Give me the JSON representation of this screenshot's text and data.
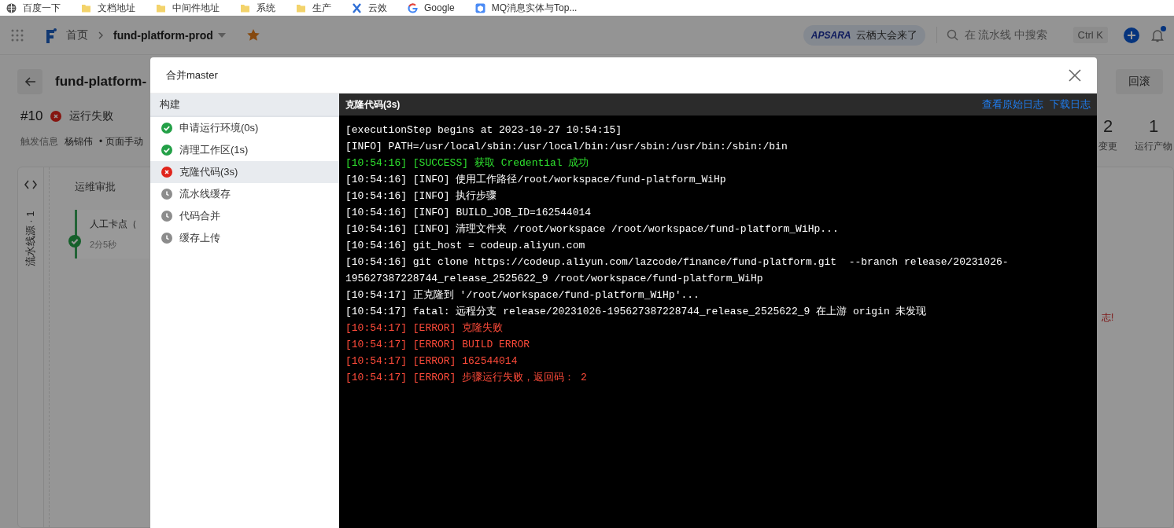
{
  "bookmarks": [
    {
      "label": "百度一下",
      "kind": "globe"
    },
    {
      "label": "文档地址",
      "kind": "folder"
    },
    {
      "label": "中间件地址",
      "kind": "folder"
    },
    {
      "label": "系统",
      "kind": "folder"
    },
    {
      "label": "生产",
      "kind": "folder"
    },
    {
      "label": "云效",
      "kind": "cross"
    },
    {
      "label": "Google",
      "kind": "google"
    },
    {
      "label": "MQ消息实体与Top...",
      "kind": "cube"
    }
  ],
  "header": {
    "breadcrumb": [
      "首页",
      "fund-platform-prod"
    ],
    "starred": true,
    "promo": {
      "logo": "APSARA",
      "text": "云栖大会来了"
    },
    "search": {
      "placeholder": "在 流水线 中搜索",
      "shortcut": "Ctrl K"
    },
    "notification_dot": true
  },
  "page": {
    "title": "fund-platform-",
    "buttons": [
      "回滚"
    ],
    "run": {
      "number": "#10",
      "status": "运行失败",
      "kind": "failed"
    },
    "trigger": {
      "label": "触发信息",
      "user": "杨锦伟",
      "detail": "• 页面手动"
    },
    "stats": [
      {
        "value": "2",
        "label": "变更"
      },
      {
        "value": "1",
        "label": "运行产物"
      }
    ],
    "source": "流水线源 · 1",
    "stage": {
      "title": "运维审批",
      "job": {
        "name": "人工卡点（",
        "duration": "2分5秒",
        "kind": "success"
      }
    },
    "error_note": "志!"
  },
  "modal": {
    "title": "合并master",
    "steps_header": "构建",
    "steps": [
      {
        "name": "申请运行环境(0s)",
        "kind": "success",
        "selected": false
      },
      {
        "name": "清理工作区(1s)",
        "kind": "success",
        "selected": false
      },
      {
        "name": "克隆代码(3s)",
        "kind": "failed",
        "selected": true
      },
      {
        "name": "流水线缓存",
        "kind": "pending",
        "selected": false
      },
      {
        "name": "代码合并",
        "kind": "pending",
        "selected": false
      },
      {
        "name": "缓存上传",
        "kind": "pending",
        "selected": false
      }
    ],
    "log": {
      "title": "克隆代码(3s)",
      "links": [
        "查看原始日志",
        "下载日志"
      ],
      "lines": [
        {
          "text": "[executionStep begins at 2023-10-27 10:54:15]",
          "kind": "plain"
        },
        {
          "text": "[INFO] PATH=/usr/local/sbin:/usr/local/bin:/usr/sbin:/usr/bin:/sbin:/bin",
          "kind": "plain"
        },
        {
          "text": "[10:54:16] [SUCCESS] 获取 Credential 成功",
          "kind": "success"
        },
        {
          "text": "[10:54:16] [INFO] 使用工作路径/root/workspace/fund-platform_WiHp",
          "kind": "plain"
        },
        {
          "text": "[10:54:16] [INFO] 执行步骤",
          "kind": "plain"
        },
        {
          "text": "[10:54:16] [INFO] BUILD_JOB_ID=162544014",
          "kind": "plain"
        },
        {
          "text": "[10:54:16] [INFO] 清理文件夹 /root/workspace /root/workspace/fund-platform_WiHp...",
          "kind": "plain"
        },
        {
          "text": "[10:54:16] git_host = codeup.aliyun.com",
          "kind": "plain"
        },
        {
          "text": "[10:54:16] git clone https://codeup.aliyun.com/lazcode/finance/fund-platform.git  --branch release/20231026-195627387228744_release_2525622_9 /root/workspace/fund-platform_WiHp",
          "kind": "plain"
        },
        {
          "text": "[10:54:17] 正克隆到 '/root/workspace/fund-platform_WiHp'...",
          "kind": "plain"
        },
        {
          "text": "[10:54:17] fatal: 远程分支 release/20231026-195627387228744_release_2525622_9 在上游 origin 未发现",
          "kind": "plain"
        },
        {
          "text": "[10:54:17] [ERROR] 克隆失败",
          "kind": "error"
        },
        {
          "text": "[10:54:17] [ERROR] BUILD ERROR",
          "kind": "error"
        },
        {
          "text": "[10:54:17] [ERROR] 162544014",
          "kind": "error"
        },
        {
          "text": "[10:54:17] [ERROR] 步骤运行失败，返回码： 2",
          "kind": "error"
        }
      ]
    }
  }
}
